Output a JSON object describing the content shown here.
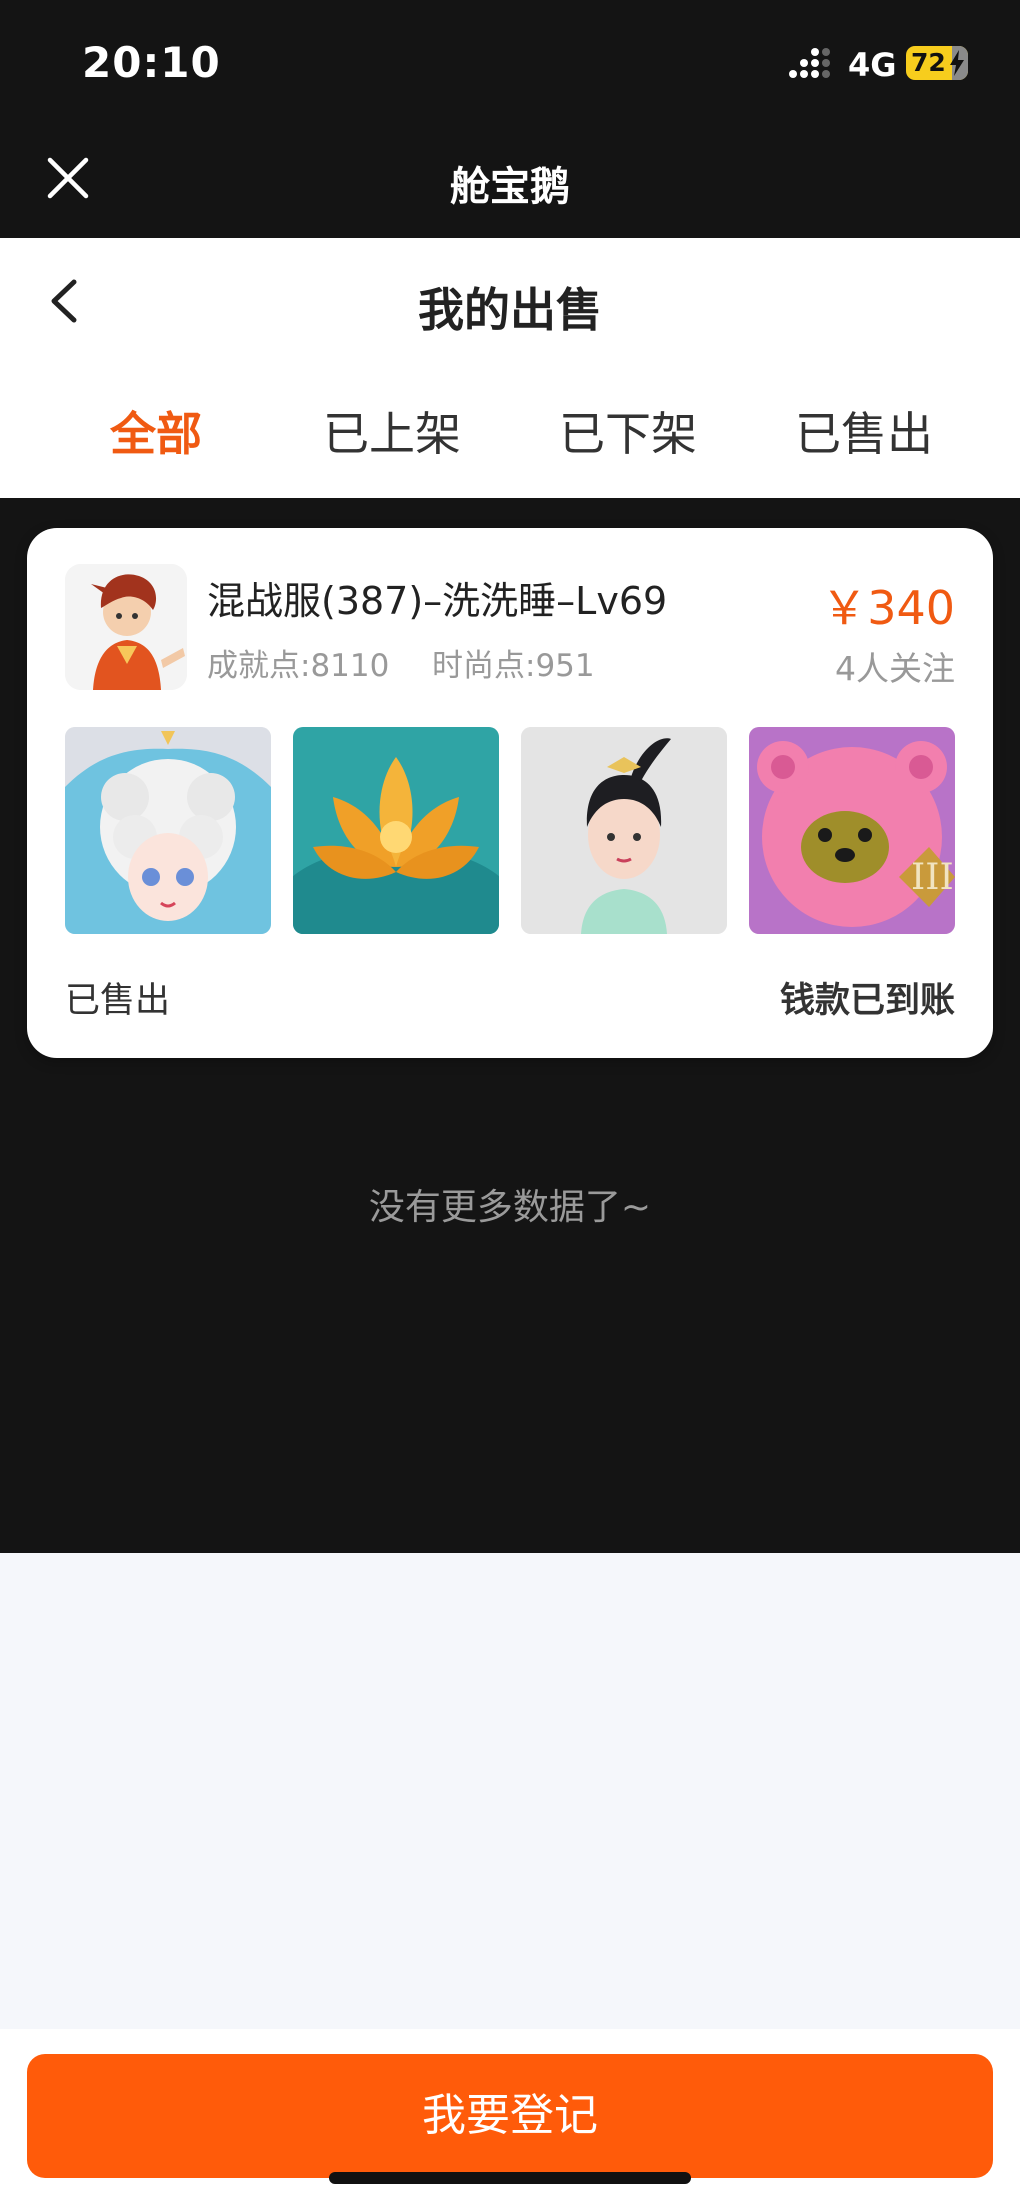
{
  "status_bar": {
    "time": "20:10",
    "network": "4G",
    "battery": "72",
    "icons": [
      "signal-icon",
      "battery-icon",
      "charging-bolt-icon"
    ]
  },
  "app_bar": {
    "title": "舱宝鹅",
    "close_icon": "close-icon"
  },
  "header": {
    "title": "我的出售",
    "back_icon": "chevron-left-icon"
  },
  "tabs": [
    {
      "label": "全部",
      "active": true
    },
    {
      "label": "已上架",
      "active": false
    },
    {
      "label": "已下架",
      "active": false
    },
    {
      "label": "已售出",
      "active": false
    }
  ],
  "listing": {
    "title": "混战服(387)–洗洗睡–Lv69",
    "achievement": "成就点:8110",
    "fashion": "时尚点:951",
    "price": "￥340",
    "watchers": "4人关注",
    "status": "已售出",
    "payment": "钱款已到账",
    "thumbnails": [
      "cloud-hair-girl-outfit",
      "golden-lotus-item",
      "dancer-girl-outfit",
      "pink-bear-mount"
    ]
  },
  "no_more_text": "没有更多数据了~",
  "register_button": "我要登记",
  "colors": {
    "accent": "#f05a12",
    "button": "#ff5b0a",
    "dark_bg": "#141414",
    "light_bg": "#f5f7fb"
  }
}
